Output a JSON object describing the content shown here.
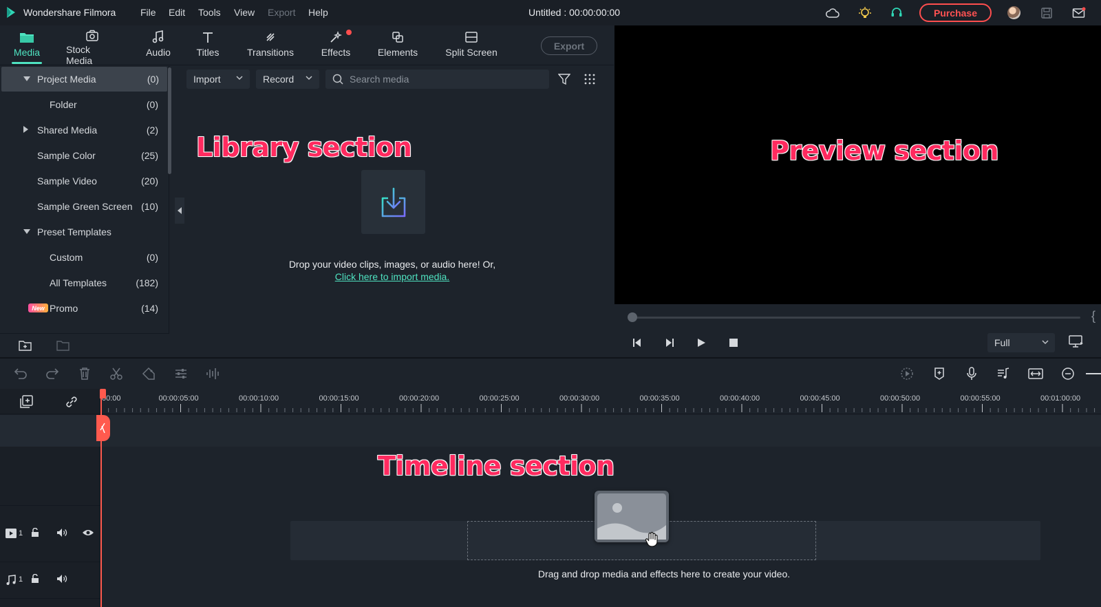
{
  "app": {
    "name": "Wondershare Filmora",
    "doc_title": "Untitled : 00:00:00:00",
    "purchase_label": "Purchase"
  },
  "menu": [
    {
      "label": "File",
      "enabled": true
    },
    {
      "label": "Edit",
      "enabled": true
    },
    {
      "label": "Tools",
      "enabled": true
    },
    {
      "label": "View",
      "enabled": true
    },
    {
      "label": "Export",
      "enabled": false
    },
    {
      "label": "Help",
      "enabled": true
    }
  ],
  "tabs": [
    {
      "label": "Media",
      "icon": "folder-icon",
      "active": true
    },
    {
      "label": "Stock Media",
      "icon": "stock-media-icon"
    },
    {
      "label": "Audio",
      "icon": "music-note-icon"
    },
    {
      "label": "Titles",
      "icon": "text-icon"
    },
    {
      "label": "Transitions",
      "icon": "transition-icon"
    },
    {
      "label": "Effects",
      "icon": "effects-icon",
      "notification": true
    },
    {
      "label": "Elements",
      "icon": "elements-icon"
    },
    {
      "label": "Split Screen",
      "icon": "split-screen-icon"
    }
  ],
  "export_label": "Export",
  "sidebar": {
    "items": [
      {
        "label": "Project Media",
        "count": "(0)",
        "expand": "down",
        "active": true
      },
      {
        "label": "Folder",
        "count": "(0)",
        "indent": 2
      },
      {
        "label": "Shared Media",
        "count": "(2)",
        "expand": "right"
      },
      {
        "label": "Sample Color",
        "count": "(25)"
      },
      {
        "label": "Sample Video",
        "count": "(20)"
      },
      {
        "label": "Sample Green Screen",
        "count": "(10)"
      },
      {
        "label": "Preset Templates",
        "count": "",
        "expand": "down"
      },
      {
        "label": "Custom",
        "count": "(0)",
        "indent": 2
      },
      {
        "label": "All Templates",
        "count": "(182)",
        "indent": 2
      },
      {
        "label": "Promo",
        "count": "(14)",
        "indent": 2,
        "badge": "New"
      }
    ]
  },
  "library": {
    "import_label": "Import",
    "record_label": "Record",
    "search_placeholder": "Search media",
    "drop_text": "Drop your video clips, images, or audio here! Or,",
    "import_link": "Click here to import media."
  },
  "annotations": {
    "library": "Library section",
    "preview": "Preview section",
    "timeline": "Timeline section"
  },
  "preview": {
    "progress": 0,
    "quality": "Full"
  },
  "timeline": {
    "ruler_labels": [
      "00:00",
      "00:00:05:00",
      "00:00:10:00",
      "00:00:15:00",
      "00:00:20:00",
      "00:00:25:00",
      "00:00:30:00",
      "00:00:35:00",
      "00:00:40:00",
      "00:00:45:00",
      "00:00:50:00",
      "00:00:55:00",
      "00:01:00:00"
    ],
    "video_track_num": "1",
    "audio_track_num": "1",
    "hint": "Drag and drop media and effects here to create your video."
  },
  "colors": {
    "accent": "#4fe3c1",
    "purchase": "#ff4e4e",
    "playhead": "#ff5a4e",
    "annotation": "#ff2a5f"
  }
}
